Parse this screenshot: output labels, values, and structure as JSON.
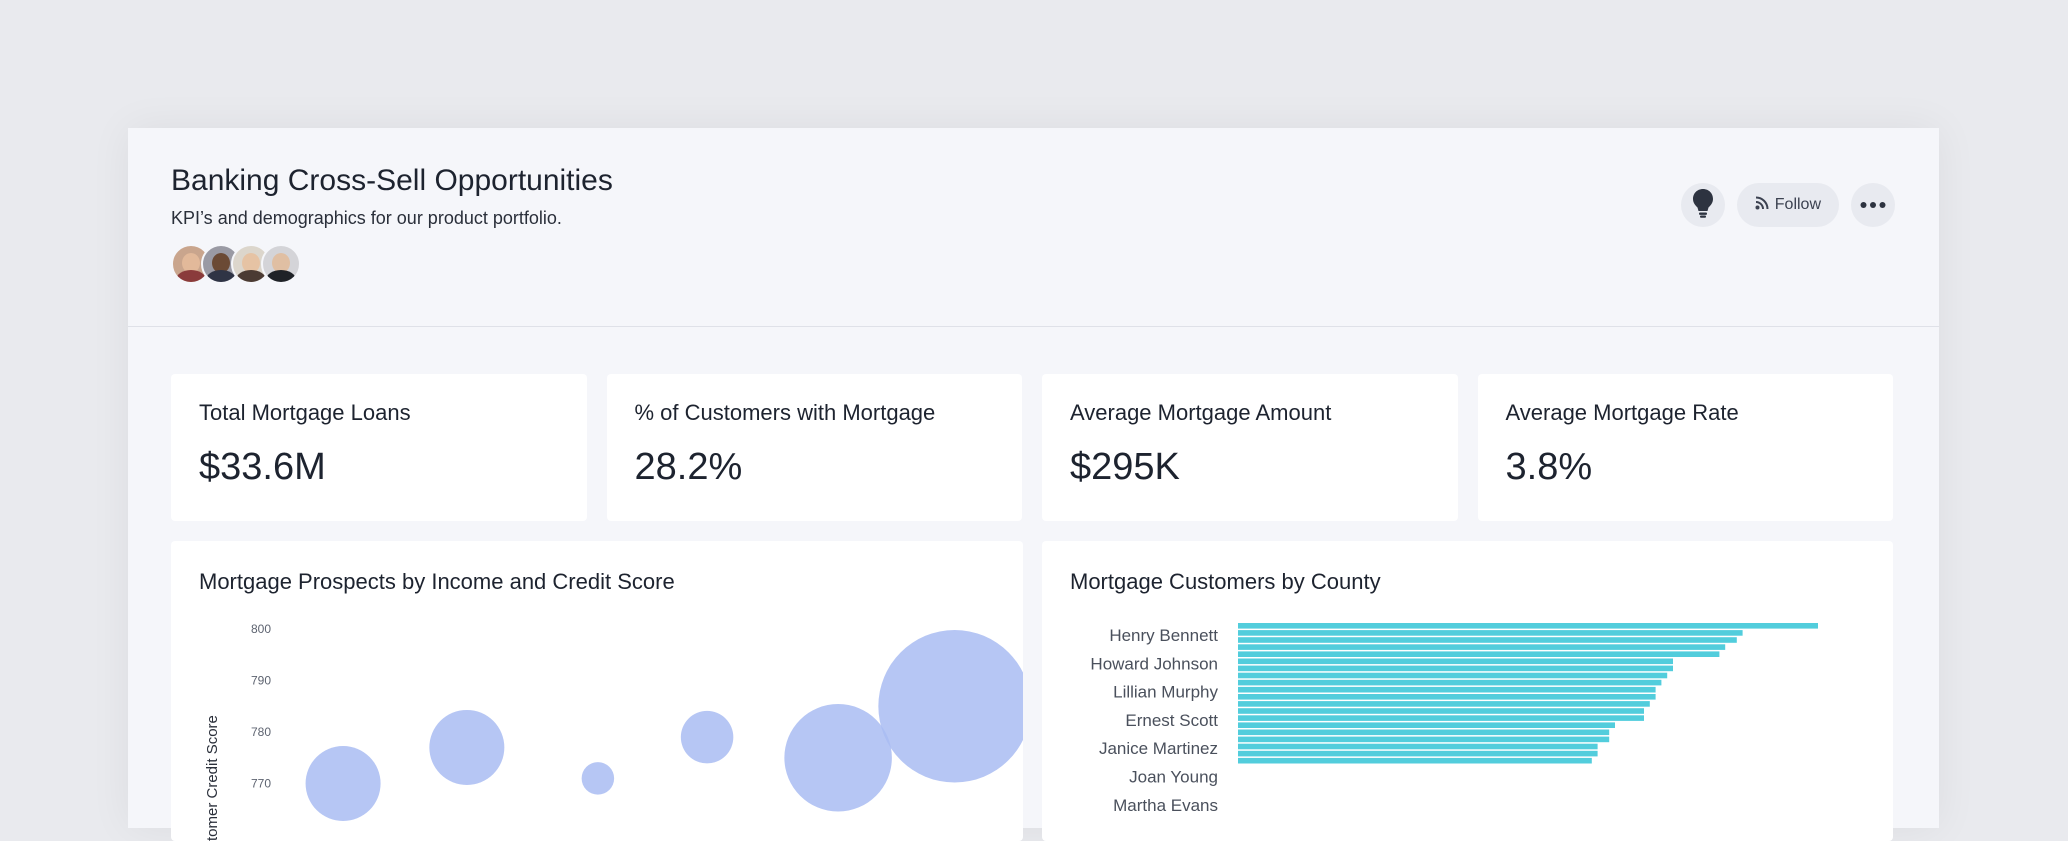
{
  "header": {
    "title": "Banking Cross-Sell Opportunities",
    "subtitle": "KPI’s and demographics for our product portfolio.",
    "follow_label": "Follow",
    "icons": [
      "lightbulb-icon",
      "rss-icon",
      "more-icon"
    ]
  },
  "kpis": [
    {
      "label": "Total Mortgage Loans",
      "value": "$33.6M"
    },
    {
      "label": "% of Customers with Mortgage",
      "value": "28.2%"
    },
    {
      "label": "Average Mortgage Amount",
      "value": "$295K"
    },
    {
      "label": "Average Mortgage Rate",
      "value": "3.8%"
    }
  ],
  "colors": {
    "bubble": "#a9bcf2",
    "bar": "#52cddc",
    "accent_text": "#1d232f"
  },
  "chart_data": [
    {
      "type": "scatter",
      "title": "Mortgage Prospects by Income and Credit Score",
      "ylabel": "tomer Credit Score",
      "yticks": [
        800,
        790,
        780,
        770
      ],
      "ylim": [
        765,
        803
      ],
      "xlim": [
        0,
        100
      ],
      "points": [
        {
          "x": 11,
          "y": 770,
          "size": 30
        },
        {
          "x": 28,
          "y": 777,
          "size": 30
        },
        {
          "x": 46,
          "y": 771,
          "size": 13
        },
        {
          "x": 61,
          "y": 779,
          "size": 21
        },
        {
          "x": 79,
          "y": 775,
          "size": 43
        },
        {
          "x": 95,
          "y": 785,
          "size": 61
        }
      ]
    },
    {
      "type": "bar",
      "orientation": "horizontal",
      "title": "Mortgage Customers by County",
      "categories": [
        "Henry Bennett",
        "Howard Johnson",
        "Lillian Murphy",
        "Ernest Scott",
        "Janice Martinez",
        "Joan Young",
        "Martha Evans"
      ],
      "values": [
        100,
        87,
        86,
        84,
        83,
        75,
        75,
        74,
        73,
        72,
        72,
        71,
        70,
        70,
        65,
        64,
        64,
        62,
        62,
        61
      ],
      "xlim": [
        0,
        100
      ]
    }
  ]
}
